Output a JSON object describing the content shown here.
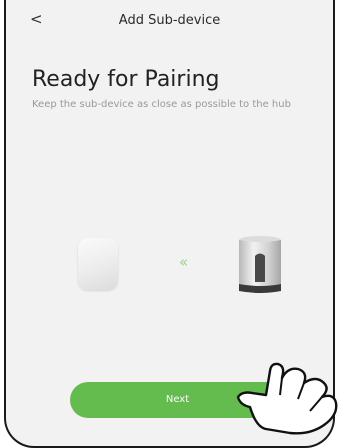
{
  "header": {
    "back_icon": "chevron-left-icon",
    "back_glyph": "<",
    "title": "Add Sub-device"
  },
  "main": {
    "heading": "Ready for Pairing",
    "subtext": "Keep the sub-device as close as possible to the hub",
    "arrows_glyph": "«",
    "arrows_color": "#9ad48a"
  },
  "footer": {
    "next_label": "Next",
    "accent": "#64bc4f"
  }
}
